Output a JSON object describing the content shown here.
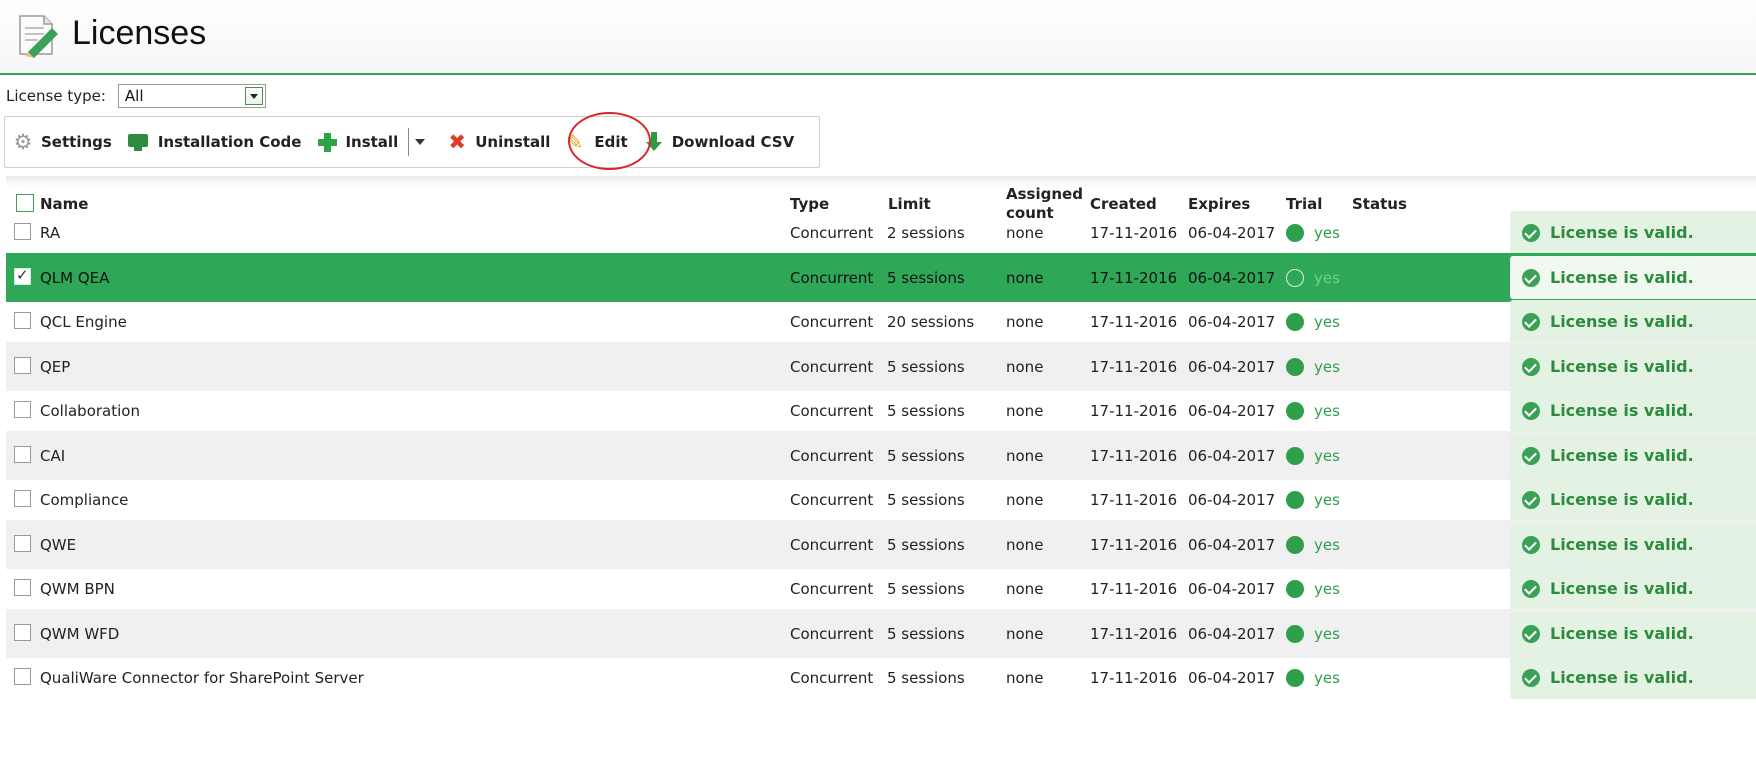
{
  "header": {
    "title": "Licenses"
  },
  "filter": {
    "label": "License type:",
    "value": "All"
  },
  "toolbar": {
    "settings": "Settings",
    "installation_code": "Installation Code",
    "install": "Install",
    "uninstall": "Uninstall",
    "edit": "Edit",
    "download_csv": "Download CSV"
  },
  "columns": {
    "name": "Name",
    "type": "Type",
    "limit": "Limit",
    "assigned_line1": "Assigned",
    "assigned_line2": "count",
    "created": "Created",
    "expires": "Expires",
    "trial": "Trial",
    "status": "Status"
  },
  "rows": [
    {
      "name": "RA",
      "type": "Concurrent",
      "limit": "2 sessions",
      "assigned": "none",
      "created": "17-11-2016",
      "expires": "06-04-2017",
      "trial": "yes",
      "status": "License is valid.",
      "checked": false
    },
    {
      "name": "QLM QEA",
      "type": "Concurrent",
      "limit": "5 sessions",
      "assigned": "none",
      "created": "17-11-2016",
      "expires": "06-04-2017",
      "trial": "yes",
      "status": "License is valid.",
      "checked": true
    },
    {
      "name": "QCL Engine",
      "type": "Concurrent",
      "limit": "20 sessions",
      "assigned": "none",
      "created": "17-11-2016",
      "expires": "06-04-2017",
      "trial": "yes",
      "status": "License is valid.",
      "checked": false
    },
    {
      "name": "QEP",
      "type": "Concurrent",
      "limit": "5 sessions",
      "assigned": "none",
      "created": "17-11-2016",
      "expires": "06-04-2017",
      "trial": "yes",
      "status": "License is valid.",
      "checked": false
    },
    {
      "name": "Collaboration",
      "type": "Concurrent",
      "limit": "5 sessions",
      "assigned": "none",
      "created": "17-11-2016",
      "expires": "06-04-2017",
      "trial": "yes",
      "status": "License is valid.",
      "checked": false
    },
    {
      "name": "CAI",
      "type": "Concurrent",
      "limit": "5 sessions",
      "assigned": "none",
      "created": "17-11-2016",
      "expires": "06-04-2017",
      "trial": "yes",
      "status": "License is valid.",
      "checked": false
    },
    {
      "name": "Compliance",
      "type": "Concurrent",
      "limit": "5 sessions",
      "assigned": "none",
      "created": "17-11-2016",
      "expires": "06-04-2017",
      "trial": "yes",
      "status": "License is valid.",
      "checked": false
    },
    {
      "name": "QWE",
      "type": "Concurrent",
      "limit": "5 sessions",
      "assigned": "none",
      "created": "17-11-2016",
      "expires": "06-04-2017",
      "trial": "yes",
      "status": "License is valid.",
      "checked": false
    },
    {
      "name": "QWM BPN",
      "type": "Concurrent",
      "limit": "5 sessions",
      "assigned": "none",
      "created": "17-11-2016",
      "expires": "06-04-2017",
      "trial": "yes",
      "status": "License is valid.",
      "checked": false
    },
    {
      "name": "QWM WFD",
      "type": "Concurrent",
      "limit": "5 sessions",
      "assigned": "none",
      "created": "17-11-2016",
      "expires": "06-04-2017",
      "trial": "yes",
      "status": "License is valid.",
      "checked": false
    },
    {
      "name": "QualiWare Connector for SharePoint Server",
      "type": "Concurrent",
      "limit": "5 sessions",
      "assigned": "none",
      "created": "17-11-2016",
      "expires": "06-04-2017",
      "trial": "yes",
      "status": "License is valid.",
      "checked": false
    }
  ],
  "colors": {
    "accent": "#2ea857",
    "valid_text": "#2d8a3f",
    "valid_bg": "#e4f2e4",
    "highlight": "#d8262c"
  }
}
